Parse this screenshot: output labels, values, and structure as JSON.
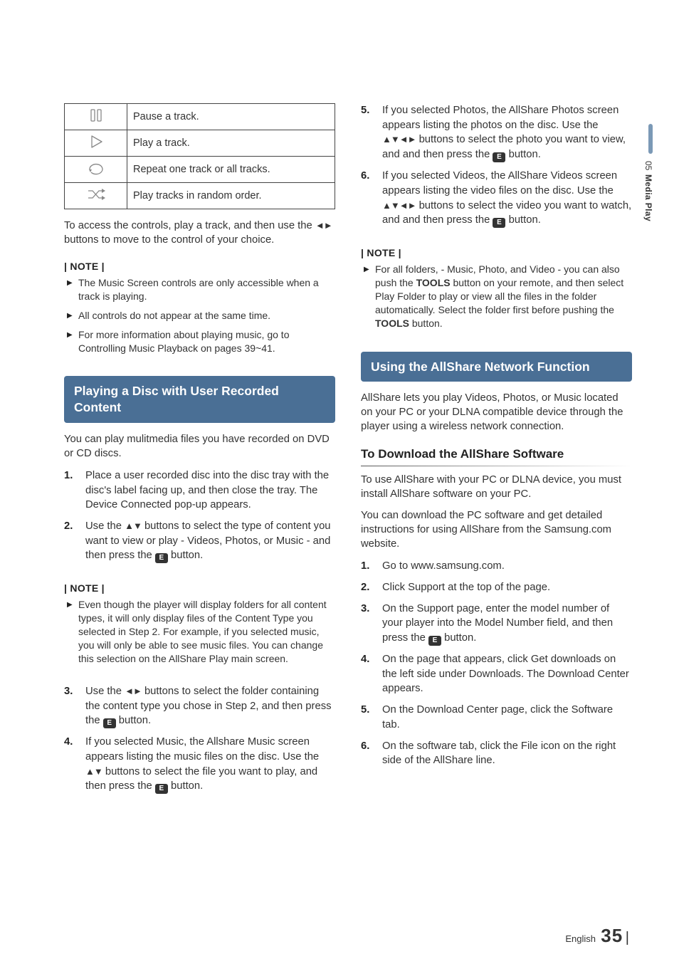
{
  "side": {
    "chapter_num": "05",
    "chapter_title": "Media Play"
  },
  "controls_table": [
    {
      "icon": "pause",
      "desc": "Pause a track."
    },
    {
      "icon": "play",
      "desc": "Play a track."
    },
    {
      "icon": "repeat",
      "desc": "Repeat one track or all tracks."
    },
    {
      "icon": "shuffle",
      "desc": "Play tracks in random order."
    }
  ],
  "left": {
    "access_text_a": "To access the controls, play a track, and then use the ",
    "access_text_b": " buttons to move to the control of your choice.",
    "note_label": "| NOTE |",
    "notes1": [
      "The Music Screen controls are only accessible when a track is playing.",
      "All controls do not appear at the same time.",
      "For more information about playing music, go to Controlling Music Playback on pages 39~41."
    ],
    "section1_title": "Playing a Disc with User Recorded Content",
    "section1_intro": "You can play mulitmedia files you have recorded on DVD or CD discs.",
    "section1_steps": {
      "s1": "Place a user recorded disc into the disc tray with the disc's label facing up, and then close the tray. The Device Connected pop-up appears.",
      "s2_a": "Use the ",
      "s2_b": " buttons to select the type of content you want to view or play - Videos, Photos, or Music - and then press the ",
      "s2_c": " button."
    },
    "notes2_hdr": "| NOTE |",
    "notes2": [
      "Even though the player will display folders for all content types, it will only display files of the Content Type you selected in Step 2. For example, if you selected music, you will only be able to see music files. You can change this selection on the AllShare Play main screen."
    ],
    "section1_steps_cont": {
      "s3_a": "Use the ",
      "s3_b": " buttons to select the folder containing the content type you chose in Step 2, and then press the ",
      "s3_c": " button.",
      "s4_a": "If you selected Music, the Allshare Music screen appears listing the music files on the disc. Use the ",
      "s4_b": " buttons to select the file you want to play, and then press the ",
      "s4_c": " button."
    }
  },
  "right": {
    "steps56": {
      "s5_a": "If you selected Photos, the AllShare Photos screen appears listing the photos on the disc. Use the ",
      "s5_b": " buttons to select the photo you want to view, and and then press the ",
      "s5_c": " button.",
      "s6_a": "If you selected Videos, the AllShare Videos screen appears listing the video files on the disc. Use the ",
      "s6_b": " buttons to select the video you want to watch, and and then press the ",
      "s6_c": " button."
    },
    "note_label": "| NOTE |",
    "notes": {
      "a": "For all folders, - Music, Photo, and Video - you can also push the ",
      "tools1": "TOOLS",
      "b": " button on your remote, and then select Play Folder to play or view all the files in the folder automatically. Select the folder first before pushing the ",
      "tools2": "TOOLS",
      "c": " button."
    },
    "section2_title": "Using the AllShare Network Function",
    "section2_intro": "AllShare lets you play Videos, Photos, or Music located on your PC or your DLNA compatible device through the player using a wireless network connection.",
    "subhead": "To Download the AllShare Software",
    "sub_intro1": "To use AllShare with your PC or DLNA device, you must install AllShare software on your PC.",
    "sub_intro2": "You can download the PC software and get detailed instructions for using AllShare from the Samsung.com website.",
    "dl_steps": {
      "s1": "Go to www.samsung.com.",
      "s2": "Click Support at the top of the page.",
      "s3_a": "On the Support page, enter the model number of your player into the Model Number field, and then press the ",
      "s3_b": " button.",
      "s4": "On the page that appears, click Get downloads on the left side under Downloads. The Download Center appears.",
      "s5": "On the Download Center page, click the Software tab.",
      "s6": "On the software tab, click the File icon on the right side of the AllShare line."
    }
  },
  "footer": {
    "lang": "English",
    "page": "35"
  }
}
